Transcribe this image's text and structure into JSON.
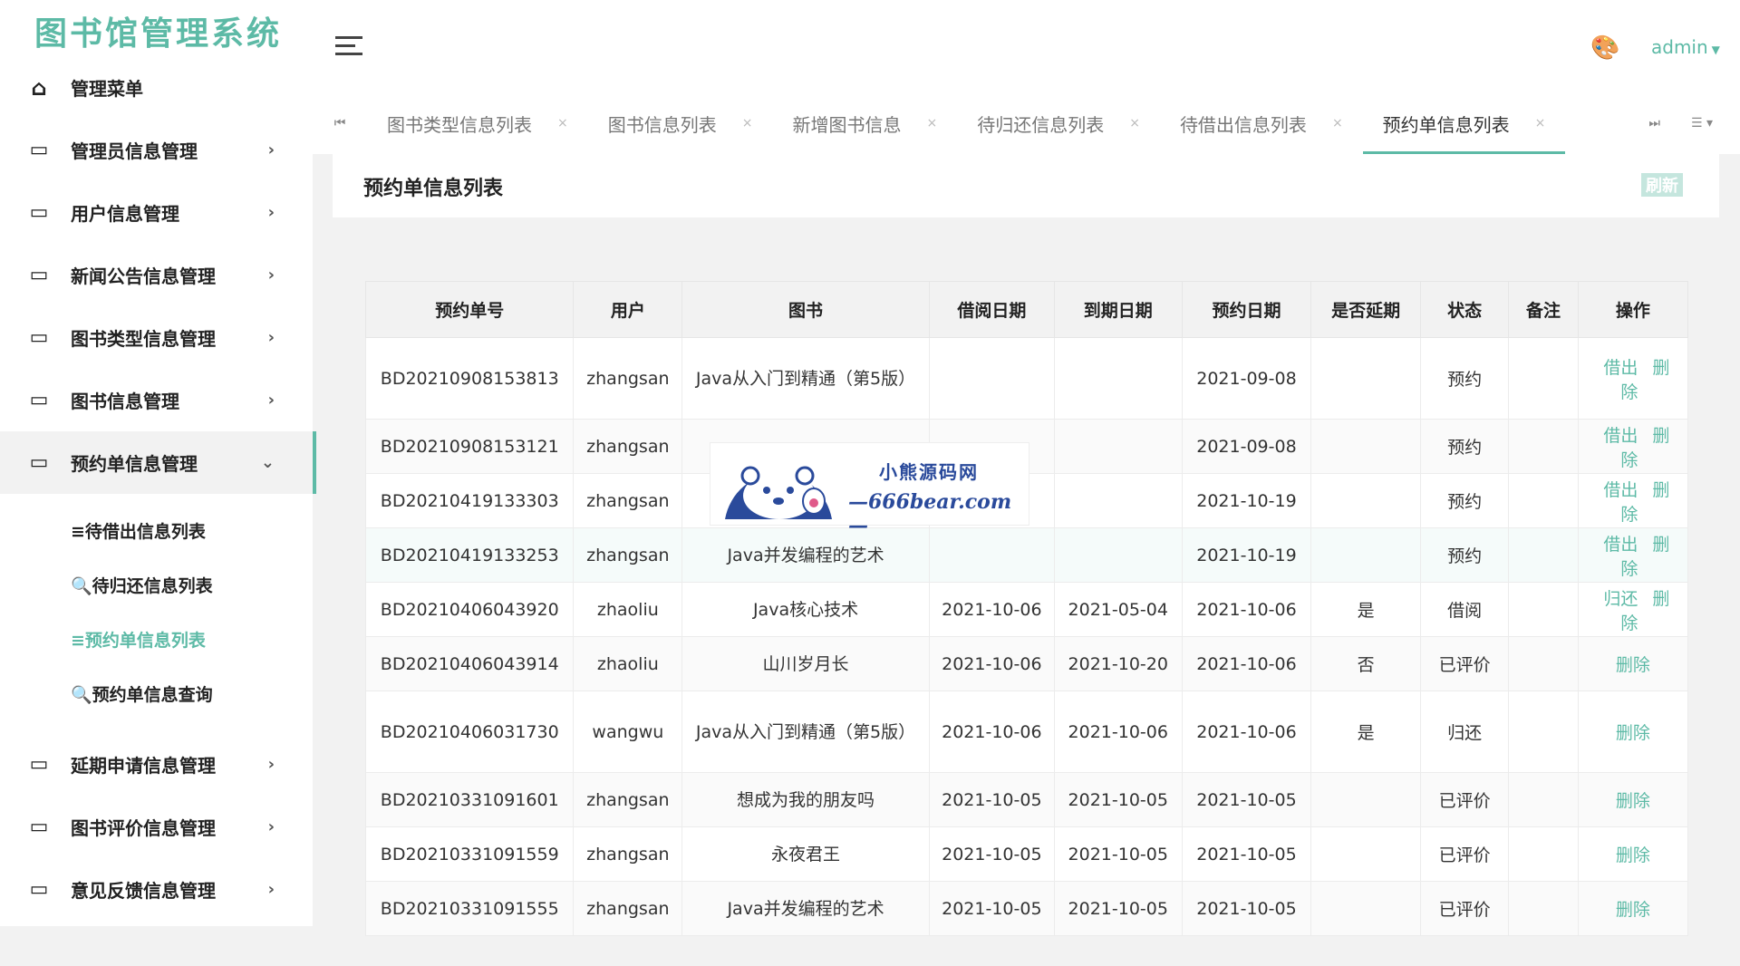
{
  "app": {
    "title": "图书馆管理系统"
  },
  "sidebar": {
    "items": [
      {
        "label": "管理菜单",
        "icon": "home-icon"
      },
      {
        "label": "管理员信息管理",
        "icon": "monitor-icon"
      },
      {
        "label": "用户信息管理",
        "icon": "monitor-icon"
      },
      {
        "label": "新闻公告信息管理",
        "icon": "monitor-icon"
      },
      {
        "label": "图书类型信息管理",
        "icon": "monitor-icon"
      },
      {
        "label": "图书信息管理",
        "icon": "monitor-icon"
      },
      {
        "label": "预约单信息管理",
        "icon": "monitor-icon",
        "expanded": true
      },
      {
        "label": "延期申请信息管理",
        "icon": "monitor-icon"
      },
      {
        "label": "图书评价信息管理",
        "icon": "monitor-icon"
      },
      {
        "label": "意见反馈信息管理",
        "icon": "monitor-icon"
      }
    ],
    "sub_items": [
      {
        "label": "≡待借出信息列表"
      },
      {
        "label": "🔍待归还信息列表"
      },
      {
        "label": "≡预约单信息列表",
        "active": true
      },
      {
        "label": "🔍预约单信息查询"
      }
    ]
  },
  "header": {
    "user": "admin"
  },
  "tabs": [
    {
      "label": "图书类型信息列表"
    },
    {
      "label": "图书信息列表"
    },
    {
      "label": "新增图书信息"
    },
    {
      "label": "待归还信息列表"
    },
    {
      "label": "待借出信息列表"
    },
    {
      "label": "预约单信息列表",
      "active": true
    }
  ],
  "page": {
    "title": "预约单信息列表",
    "refresh": "刷新"
  },
  "table": {
    "headers": [
      "预约单号",
      "用户",
      "图书",
      "借阅日期",
      "到期日期",
      "预约日期",
      "是否延期",
      "状态",
      "备注",
      "操作"
    ],
    "rows": [
      {
        "id": "BD20210908153813",
        "user": "zhangsan",
        "book": "Java从入门到精通（第5版）",
        "borrow": "",
        "due": "",
        "reserve": "2021-09-08",
        "ext": "",
        "status": "预约",
        "note": "",
        "actions": [
          "借出",
          "删除"
        ]
      },
      {
        "id": "BD20210908153121",
        "user": "zhangsan",
        "book": "",
        "borrow": "",
        "due": "",
        "reserve": "2021-09-08",
        "ext": "",
        "status": "预约",
        "note": "",
        "actions": [
          "借出",
          "删除"
        ]
      },
      {
        "id": "BD20210419133303",
        "user": "zhangsan",
        "book": "",
        "borrow": "",
        "due": "",
        "reserve": "2021-10-19",
        "ext": "",
        "status": "预约",
        "note": "",
        "actions": [
          "借出",
          "删除"
        ]
      },
      {
        "id": "BD20210419133253",
        "user": "zhangsan",
        "book": "Java并发编程的艺术",
        "borrow": "",
        "due": "",
        "reserve": "2021-10-19",
        "ext": "",
        "status": "预约",
        "note": "",
        "actions": [
          "借出",
          "删除"
        ]
      },
      {
        "id": "BD20210406043920",
        "user": "zhaoliu",
        "book": "Java核心技术",
        "borrow": "2021-10-06",
        "due": "2021-05-04",
        "reserve": "2021-10-06",
        "ext": "是",
        "status": "借阅",
        "note": "",
        "actions": [
          "归还",
          "删除"
        ]
      },
      {
        "id": "BD20210406043914",
        "user": "zhaoliu",
        "book": "山川岁月长",
        "borrow": "2021-10-06",
        "due": "2021-10-20",
        "reserve": "2021-10-06",
        "ext": "否",
        "status": "已评价",
        "note": "",
        "actions": [
          "删除"
        ]
      },
      {
        "id": "BD20210406031730",
        "user": "wangwu",
        "book": "Java从入门到精通（第5版）",
        "borrow": "2021-10-06",
        "due": "2021-10-06",
        "reserve": "2021-10-06",
        "ext": "是",
        "status": "归还",
        "note": "",
        "actions": [
          "删除"
        ]
      },
      {
        "id": "BD20210331091601",
        "user": "zhangsan",
        "book": "想成为我的朋友吗",
        "borrow": "2021-10-05",
        "due": "2021-10-05",
        "reserve": "2021-10-05",
        "ext": "",
        "status": "已评价",
        "note": "",
        "actions": [
          "删除"
        ]
      },
      {
        "id": "BD20210331091559",
        "user": "zhangsan",
        "book": "永夜君王",
        "borrow": "2021-10-05",
        "due": "2021-10-05",
        "reserve": "2021-10-05",
        "ext": "",
        "status": "已评价",
        "note": "",
        "actions": [
          "删除"
        ]
      },
      {
        "id": "BD20210331091555",
        "user": "zhangsan",
        "book": "Java并发编程的艺术",
        "borrow": "2021-10-05",
        "due": "2021-10-05",
        "reserve": "2021-10-05",
        "ext": "",
        "status": "已评价",
        "note": "",
        "actions": [
          "删除"
        ]
      }
    ]
  },
  "watermark": {
    "line1": "小熊源码网",
    "line2": "—666bear.com—"
  },
  "colors": {
    "accent": "#5dbaa6",
    "watermark": "#2a4a9b"
  }
}
